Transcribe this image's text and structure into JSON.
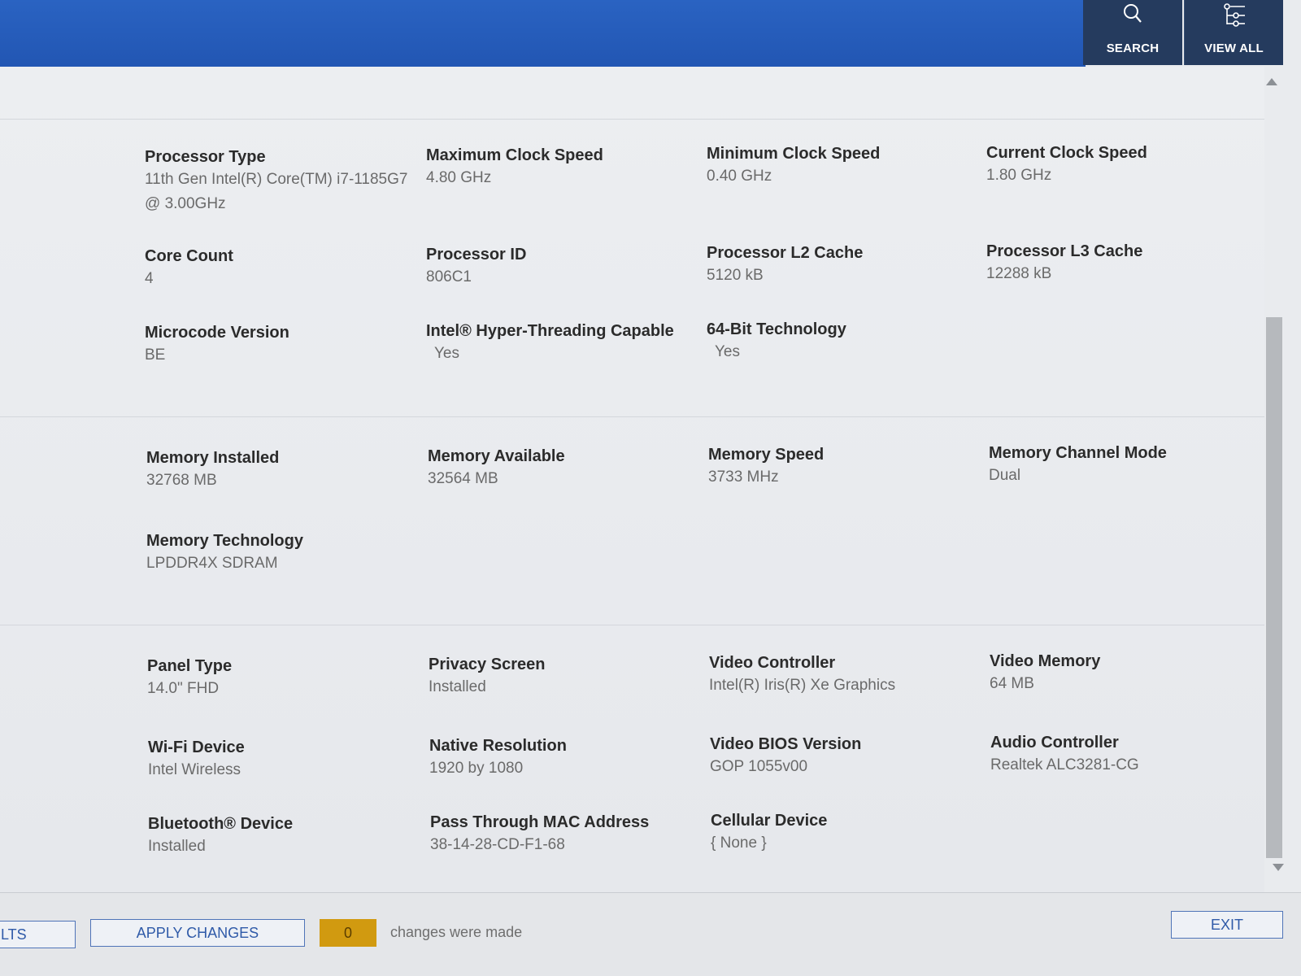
{
  "header": {
    "search_label": "SEARCH",
    "view_all_label": "VIEW ALL"
  },
  "processor": {
    "type_label": "Processor Type",
    "type_value_line1": "11th Gen Intel(R) Core(TM) i7-1185G7",
    "type_value_line2": "@ 3.00GHz",
    "max_clock_label": "Maximum Clock Speed",
    "max_clock_value": "4.80 GHz",
    "min_clock_label": "Minimum Clock Speed",
    "min_clock_value": "0.40 GHz",
    "cur_clock_label": "Current Clock Speed",
    "cur_clock_value": "1.80 GHz",
    "core_count_label": "Core Count",
    "core_count_value": "4",
    "id_label": "Processor ID",
    "id_value": "806C1",
    "l2_label": "Processor L2 Cache",
    "l2_value": "5120 kB",
    "l3_label": "Processor L3 Cache",
    "l3_value": "12288 kB",
    "microcode_label": "Microcode Version",
    "microcode_value": "BE",
    "ht_label": "Intel® Hyper-Threading Capable",
    "ht_value": "Yes",
    "bit64_label": "64-Bit Technology",
    "bit64_value": "Yes"
  },
  "memory": {
    "installed_label": "Memory Installed",
    "installed_value": "32768 MB",
    "available_label": "Memory Available",
    "available_value": "32564 MB",
    "speed_label": "Memory Speed",
    "speed_value": "3733 MHz",
    "channel_label": "Memory Channel Mode",
    "channel_value": "Dual",
    "tech_label": "Memory Technology",
    "tech_value": "LPDDR4X SDRAM"
  },
  "devices": {
    "panel_label": "Panel Type",
    "panel_value": "14.0\" FHD",
    "privacy_label": "Privacy Screen",
    "privacy_value": "Installed",
    "video_ctrl_label": "Video Controller",
    "video_ctrl_value": "Intel(R) Iris(R) Xe Graphics",
    "video_mem_label": "Video Memory",
    "video_mem_value": "64 MB",
    "wifi_label": "Wi-Fi Device",
    "wifi_value": "Intel Wireless",
    "native_res_label": "Native Resolution",
    "native_res_value": "1920 by 1080",
    "vbios_label": "Video BIOS Version",
    "vbios_value": "GOP 1055v00",
    "audio_label": "Audio Controller",
    "audio_value": "Realtek ALC3281-CG",
    "bt_label": "Bluetooth® Device",
    "bt_value": "Installed",
    "mac_label": "Pass Through MAC Address",
    "mac_value": "38-14-28-CD-F1-68",
    "cell_label": "Cellular Device",
    "cell_value": "{ None }"
  },
  "footer": {
    "defaults_label": "LTS",
    "apply_label": "APPLY CHANGES",
    "changes_count": "0",
    "changes_text": "changes were made",
    "exit_label": "EXIT"
  },
  "colors": {
    "header_blue": "#2a63c2",
    "nav_dark": "#253b5e",
    "counter_amber": "#d19a10",
    "button_blue": "#2f5aa8"
  }
}
